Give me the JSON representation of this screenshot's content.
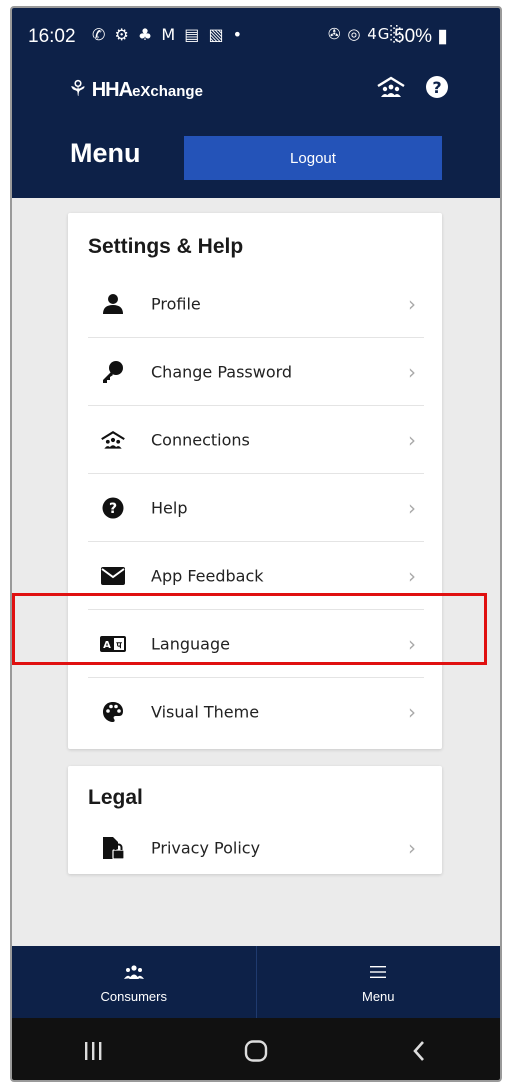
{
  "status_bar": {
    "time": "16:02",
    "notification_icons": "✆ ⚙ ♣ M ▤ ▧ •",
    "signal": "✇ ◎ 4G░",
    "battery": "50%"
  },
  "brand": {
    "logo_mark": "⚘",
    "logo_strong": "HHA",
    "logo_small": "eXchange"
  },
  "header": {
    "title": "Menu",
    "logout_label": "Logout"
  },
  "settings_section": {
    "title": "Settings & Help",
    "items": [
      {
        "label": "Profile",
        "icon": "person-icon"
      },
      {
        "label": "Change Password",
        "icon": "key-icon"
      },
      {
        "label": "Connections",
        "icon": "connections-icon"
      },
      {
        "label": "Help",
        "icon": "question-circle-icon"
      },
      {
        "label": "App Feedback",
        "icon": "envelope-icon"
      },
      {
        "label": "Language",
        "icon": "language-icon"
      },
      {
        "label": "Visual Theme",
        "icon": "palette-icon"
      }
    ]
  },
  "legal_section": {
    "title": "Legal",
    "items": [
      {
        "label": "Privacy Policy",
        "icon": "document-lock-icon"
      }
    ]
  },
  "tabbar": {
    "tabs": [
      {
        "label": "Consumers",
        "icon": "consumers-icon"
      },
      {
        "label": "Menu",
        "icon": "hamburger-icon"
      }
    ]
  },
  "colors": {
    "navy": "#0d2148",
    "button_blue": "#2453b8",
    "highlight_red": "#e01010",
    "background": "#ebebeb"
  }
}
